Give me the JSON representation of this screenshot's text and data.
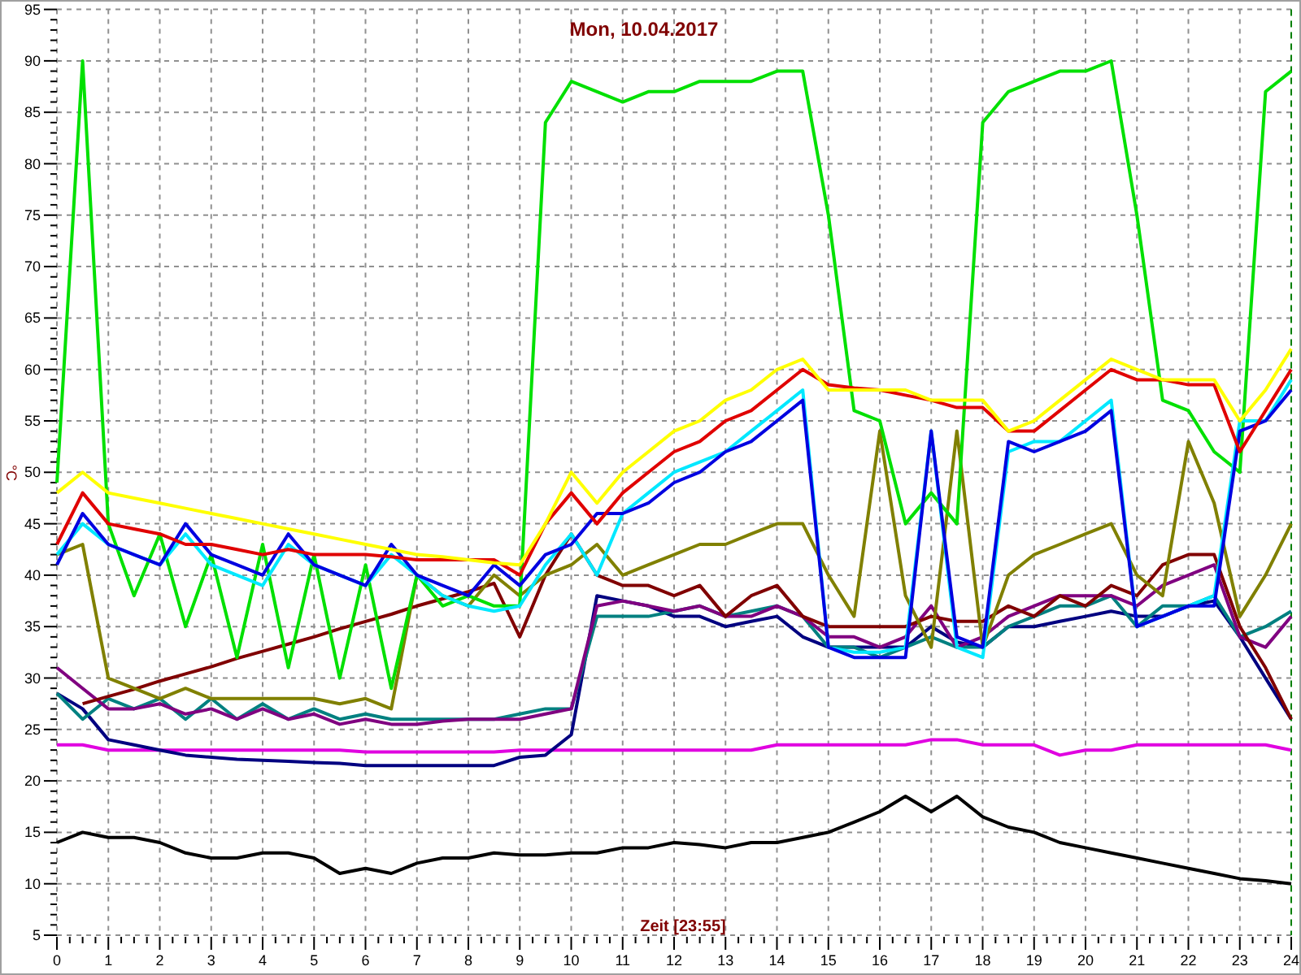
{
  "chart_data": {
    "type": "line",
    "grid": true,
    "title": "Mon, 10.04.2017",
    "xlabel": "Zeit [23:55]",
    "ylabel": "°C",
    "xlim": [
      0,
      24
    ],
    "ylim": [
      5,
      95
    ],
    "xticks": [
      0,
      1,
      2,
      3,
      4,
      5,
      6,
      7,
      8,
      9,
      10,
      11,
      12,
      13,
      14,
      15,
      16,
      17,
      18,
      19,
      20,
      21,
      22,
      23,
      24
    ],
    "yticks": [
      5,
      10,
      15,
      20,
      25,
      30,
      35,
      40,
      45,
      50,
      55,
      60,
      65,
      70,
      75,
      80,
      85,
      90,
      95
    ],
    "x": [
      0,
      0.5,
      1,
      1.5,
      2,
      2.5,
      3,
      3.5,
      4,
      4.5,
      5,
      5.5,
      6,
      6.5,
      7,
      7.5,
      8,
      8.5,
      9,
      9.5,
      10,
      10.5,
      11,
      11.5,
      12,
      12.5,
      13,
      13.5,
      14,
      14.5,
      15,
      15.5,
      16,
      16.5,
      17,
      17.5,
      18,
      18.5,
      19,
      19.5,
      20,
      20.5,
      21,
      21.5,
      22,
      22.5,
      23,
      23.5,
      24
    ],
    "series": [
      {
        "color": "#000000",
        "values": [
          14,
          15,
          14.5,
          14.5,
          14,
          13,
          12.5,
          12.5,
          13,
          13,
          12.5,
          11,
          11.5,
          11,
          12,
          12.5,
          12.5,
          13,
          12.8,
          12.8,
          13,
          13,
          13.5,
          13.5,
          14,
          13.8,
          13.5,
          14,
          14,
          14.5,
          15,
          16,
          17,
          18.5,
          17,
          18.5,
          16.5,
          15.5,
          15,
          14,
          13.5,
          13,
          12.5,
          12,
          11.5,
          11,
          10.5,
          10.3,
          10
        ]
      },
      {
        "color": "#e000e0",
        "values": [
          23.5,
          23.5,
          23,
          23,
          23,
          23,
          23,
          23,
          23,
          23,
          23,
          23,
          22.8,
          22.8,
          22.8,
          22.8,
          22.8,
          22.8,
          23,
          23,
          23,
          23,
          23,
          23,
          23,
          23,
          23,
          23,
          23.5,
          23.5,
          23.5,
          23.5,
          23.5,
          23.5,
          24,
          24,
          23.5,
          23.5,
          23.5,
          22.5,
          23,
          23,
          23.5,
          23.5,
          23.5,
          23.5,
          23.5,
          23.5,
          23
        ]
      },
      {
        "color": "#000080",
        "values": [
          28.5,
          27,
          24,
          23.5,
          23,
          22.5,
          22.3,
          22.1,
          22,
          21.9,
          21.8,
          21.7,
          21.5,
          21.5,
          21.5,
          21.5,
          21.5,
          21.5,
          22.3,
          22.5,
          24.5,
          38,
          37.5,
          37,
          36,
          36,
          35,
          35.5,
          36,
          34,
          33,
          33,
          33,
          33,
          35,
          33.5,
          33,
          35,
          35,
          35.5,
          36,
          36.5,
          36,
          36,
          37,
          37.5,
          34,
          30,
          26
        ]
      },
      {
        "color": "#008080",
        "values": [
          28.5,
          26,
          28,
          27,
          28,
          26,
          28,
          26,
          27.5,
          26,
          27,
          26,
          26.5,
          26,
          26,
          26,
          26,
          26,
          26.5,
          27,
          27,
          36,
          36,
          36,
          36.5,
          37,
          36,
          36.5,
          37,
          36,
          33,
          33,
          32,
          33,
          34,
          33,
          33,
          35,
          36,
          37,
          37,
          38,
          35,
          37,
          37,
          38,
          34,
          35,
          36.5
        ]
      },
      {
        "color": "#800080",
        "values": [
          31,
          29,
          27,
          27,
          27.5,
          26.5,
          27,
          26,
          27,
          26,
          26.5,
          25.5,
          26,
          25.5,
          25.5,
          25.8,
          26,
          26,
          26,
          26.5,
          27,
          37,
          37.5,
          37,
          36.5,
          37,
          36,
          36,
          37,
          36,
          34,
          34,
          33,
          34,
          37,
          33,
          34,
          36,
          37,
          38,
          38,
          38,
          37,
          39,
          40,
          41,
          34,
          33,
          36
        ]
      },
      {
        "color": "#800000",
        "values": [
          null,
          27.5,
          28.2,
          28.9,
          29.7,
          30.4,
          31.1,
          31.9,
          32.6,
          33.3,
          34,
          34.8,
          35.5,
          36.2,
          37,
          37.7,
          38.4,
          39.2,
          34,
          40,
          44,
          40,
          39,
          39,
          38,
          39,
          36,
          38,
          39,
          36,
          35,
          35,
          35,
          35,
          36,
          35.5,
          35.5,
          37,
          36,
          38,
          37,
          39,
          38,
          41,
          42,
          42,
          35,
          31,
          26
        ]
      },
      {
        "color": "#808000",
        "values": [
          42,
          43,
          30,
          29,
          28,
          29,
          28,
          28,
          28,
          28,
          28,
          27.5,
          28,
          27,
          40,
          38,
          37,
          40,
          38,
          40,
          41,
          43,
          40,
          41,
          42,
          43,
          43,
          44,
          45,
          45,
          40,
          36,
          54,
          38,
          33,
          54,
          33,
          40,
          42,
          43,
          44,
          45,
          40,
          38,
          53,
          47,
          36,
          40,
          45
        ]
      },
      {
        "color": "#00e000",
        "values": [
          49,
          90,
          45,
          38,
          44,
          35,
          42,
          32,
          43,
          31,
          42,
          30,
          41,
          29,
          40,
          37,
          38,
          37,
          37,
          84,
          88,
          87,
          86,
          87,
          87,
          88,
          88,
          88,
          89,
          89,
          75,
          56,
          55,
          45,
          48,
          45,
          84,
          87,
          88,
          89,
          89,
          90,
          75,
          57,
          56,
          52,
          50,
          87,
          89
        ]
      },
      {
        "color": "#00e8ff",
        "values": [
          42,
          45,
          43,
          42,
          41,
          44,
          41,
          40,
          39,
          43,
          41,
          40,
          39,
          42,
          40,
          38,
          37,
          36.5,
          37,
          41,
          44,
          40,
          46,
          48,
          50,
          51,
          52,
          54,
          56,
          58,
          33,
          32.5,
          32.5,
          33,
          54,
          33,
          32,
          52,
          53,
          53,
          55,
          57,
          35,
          36,
          37,
          38,
          55,
          55,
          59
        ]
      },
      {
        "color": "#0000e0",
        "values": [
          41,
          46,
          43,
          42,
          41,
          45,
          42,
          41,
          40,
          44,
          41,
          40,
          39,
          43,
          40,
          39,
          38,
          41,
          39,
          42,
          43,
          46,
          46,
          47,
          49,
          50,
          52,
          53,
          55,
          57,
          33,
          32,
          32,
          32,
          54,
          34,
          33,
          53,
          52,
          53,
          54,
          56,
          35,
          36,
          37,
          37,
          54,
          55,
          58
        ]
      },
      {
        "color": "#e00000",
        "values": [
          43,
          48,
          45,
          44.5,
          44,
          43,
          43,
          42.5,
          42,
          42.5,
          42,
          42,
          42,
          41.8,
          41.5,
          41.5,
          41.5,
          41.5,
          40,
          45,
          48,
          45,
          48,
          50,
          52,
          53,
          55,
          56,
          58,
          60,
          58.5,
          58.2,
          58,
          57.5,
          57,
          56.3,
          56.3,
          54,
          54,
          56,
          58,
          60,
          59,
          59,
          58.5,
          58.5,
          52,
          56,
          60
        ]
      },
      {
        "color": "#ffff00",
        "values": [
          48,
          50,
          48,
          47.5,
          47,
          46.5,
          46,
          45.5,
          45,
          44.5,
          44,
          43.5,
          43,
          42.5,
          42,
          41.8,
          41.5,
          41.2,
          41,
          45,
          50,
          47,
          50,
          52,
          54,
          55,
          57,
          58,
          60,
          61,
          58,
          58,
          58,
          58,
          57,
          57,
          57,
          54,
          55,
          57,
          59,
          61,
          60,
          59,
          59,
          59,
          55,
          58,
          62
        ]
      }
    ]
  }
}
